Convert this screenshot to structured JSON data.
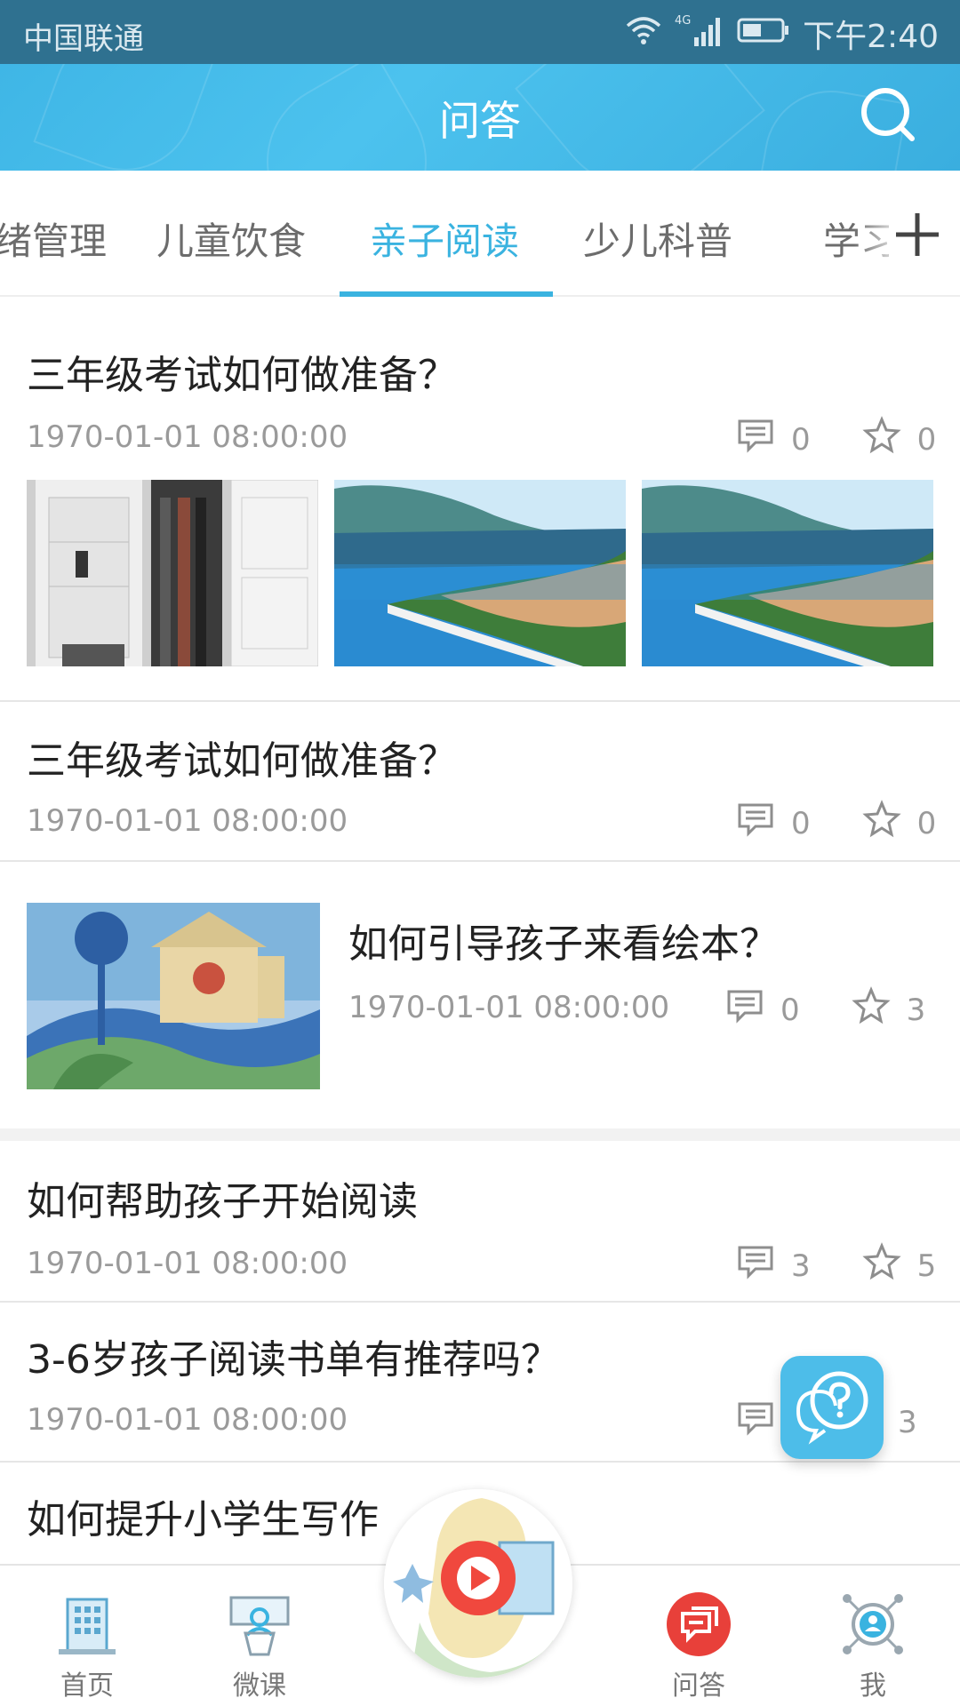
{
  "status_bar": {
    "carrier": "中国联通",
    "network": "4G",
    "time": "下午2:40"
  },
  "header": {
    "title": "问答",
    "search_icon": "search-icon"
  },
  "tabs": [
    {
      "label": "绪管理",
      "active": false
    },
    {
      "label": "儿童饮食",
      "active": false
    },
    {
      "label": "亲子阅读",
      "active": true
    },
    {
      "label": "少儿科普",
      "active": false
    },
    {
      "label": "学习",
      "active": false
    }
  ],
  "tab_add_icon": "plus-icon",
  "colors": {
    "accent": "#3ab3e0",
    "header": "#45bbe9",
    "status_bar": "#2f7190",
    "play_red": "#f0483e"
  },
  "questions": [
    {
      "title": "三年级考试如何做准备？",
      "date": "1970-01-01 08:00:00",
      "comments": "0",
      "favorites": "0",
      "images": [
        "closet",
        "lake-town",
        "lake-town"
      ]
    },
    {
      "title": "三年级考试如何做准备？",
      "date": "1970-01-01 08:00:00",
      "comments": "0",
      "favorites": "0"
    },
    {
      "title": "如何引导孩子来看绘本？",
      "date": "1970-01-01 08:00:00",
      "comments": "0",
      "favorites": "3",
      "images": [
        "picture-book"
      ]
    },
    {
      "title": "如何帮助孩子开始阅读",
      "date": "1970-01-01 08:00:00",
      "comments": "3",
      "favorites": "5"
    },
    {
      "title": "3-6岁孩子阅读书单有推荐吗？",
      "date": "1970-01-01 08:00:00",
      "comments": "",
      "favorites": "3"
    },
    {
      "title": "如何提升小学生写作",
      "date": "",
      "comments": "",
      "favorites": ""
    }
  ],
  "fab_icon": "question-bubble-icon",
  "bottom_nav": [
    {
      "label": "首页",
      "icon": "building-icon"
    },
    {
      "label": "微课",
      "icon": "lecture-icon"
    },
    {
      "label": "",
      "icon": "play-icon"
    },
    {
      "label": "问答",
      "icon": "qa-icon"
    },
    {
      "label": "我",
      "icon": "profile-icon"
    }
  ]
}
